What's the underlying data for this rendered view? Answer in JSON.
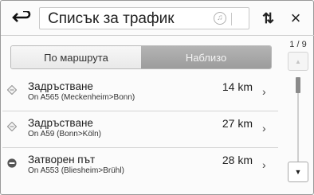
{
  "header": {
    "back_icon": "back-arrow-icon",
    "title": "Списък за трафик",
    "music_icon": "music-note-icon",
    "sort_icon": "sort-arrows-icon",
    "sort_glyph": "⇅",
    "close_glyph": "×"
  },
  "tabs": [
    {
      "label": "По маршрута",
      "active": false
    },
    {
      "label": "Наблизо",
      "active": true
    }
  ],
  "pagination": {
    "label": "1 / 9"
  },
  "items": [
    {
      "title": "Задръстване",
      "subtitle": "On A565 (Meckenheim>Bonn)",
      "distance": "14 km",
      "icon": "traffic-jam-icon"
    },
    {
      "title": "Задръстване",
      "subtitle": "On A59 (Bonn>Köln)",
      "distance": "27 km",
      "icon": "traffic-jam-icon"
    },
    {
      "title": "Затворен път",
      "subtitle": "On A553 (Bliesheim>Brühl)",
      "distance": "28 km",
      "icon": "road-closed-icon"
    }
  ],
  "scroll": {
    "position": 0.0
  },
  "colors": {
    "active_tab": "#a8a8a8",
    "warning_icon": "#9a9a9a"
  }
}
